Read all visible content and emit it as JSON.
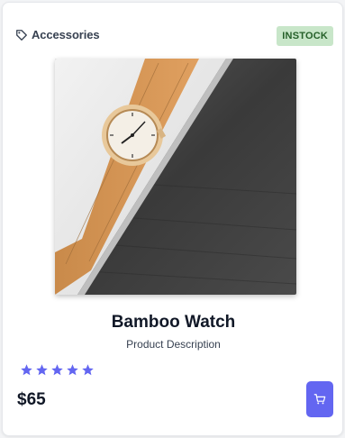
{
  "product": {
    "category": "Accessories",
    "category_icon": "tag-icon",
    "inventory_status": "INSTOCK",
    "name": "Bamboo Watch",
    "description": "Product Description",
    "rating": 5,
    "rating_max": 5,
    "price": "$65",
    "image_subject": "wooden-watch-photo"
  },
  "colors": {
    "accent": "#6366f1",
    "badge_bg": "#c8e6c9",
    "badge_text": "#256029",
    "star": "#6366f1"
  },
  "actions": {
    "cart_icon": "shopping-cart-icon"
  }
}
